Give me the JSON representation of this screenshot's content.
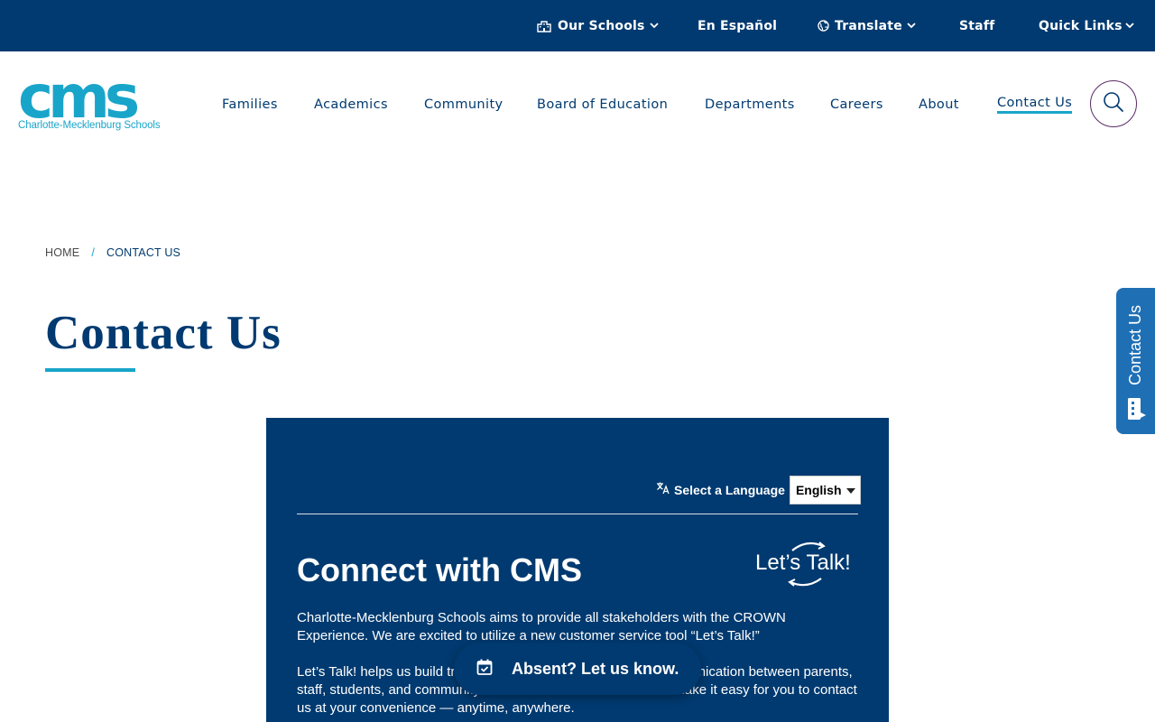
{
  "topbar": {
    "our_schools": "Our Schools",
    "en_espanol": "En Español",
    "translate": "Translate",
    "staff": "Staff",
    "quick_links": "Quick Links"
  },
  "logo": {
    "mark": "cms",
    "subtitle": "Charlotte-Mecklenburg Schools"
  },
  "nav": {
    "items": [
      "Families",
      "Academics",
      "Community",
      "Board of Education",
      "Departments",
      "Careers",
      "About",
      "Contact Us"
    ],
    "active": "Contact Us"
  },
  "breadcrumb": {
    "home": "HOME",
    "separator": "/",
    "current": "CONTACT US"
  },
  "page": {
    "title": "Contact Us"
  },
  "side_tab": {
    "label": "Contact Us"
  },
  "card": {
    "language_label": "Select a Language",
    "language_value": "English",
    "title": "Connect with CMS",
    "logo_text": "Let’s Talk!",
    "paragraph1": "Charlotte-Mecklenburg Schools aims to provide all stakeholders with the CROWN Experience. We are excited to utilize a new customer service tool “Let’s Talk!”",
    "paragraph2": "Let’s Talk! helps us build trusted relationships and enhance communication between parents, staff, students, and community members to make sure that we make it easy for you to contact us at your convenience — anytime, anywhere."
  },
  "absent_pill": {
    "label": "Absent? Let us know."
  },
  "colors": {
    "navy": "#003a70",
    "accent": "#19a5c9",
    "side_tab": "#1f6fb5",
    "search_ring": "#5b2a67"
  }
}
